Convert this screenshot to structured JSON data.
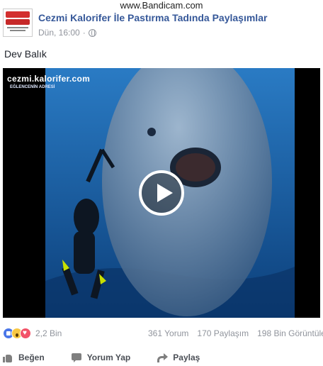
{
  "watermark": "www.Bandicam.com",
  "post": {
    "page_name": "Cezmi Kalorifer İle Pastırma Tadında Paylaşımlar",
    "timestamp": "Dün, 16:00",
    "separator": "·",
    "privacy_icon": "globe-icon",
    "text": "Dev Balık"
  },
  "avatar": {
    "logo_alt": "cezmi kalorifer logo"
  },
  "video": {
    "overlay_title": "cezmi.kalorifer.com",
    "overlay_subtitle": "EĞLENCENİN ADRESİ",
    "play_icon": "play-icon",
    "colors": {
      "water_top": "#1f6fb8",
      "water_bottom": "#0b3e78",
      "fish": "#8fa6bf"
    }
  },
  "stats": {
    "reactions": [
      "like-reaction-icon",
      "wow-reaction-icon",
      "love-reaction-icon"
    ],
    "reaction_count": "2,2 Bin",
    "comments": "361 Yorum",
    "shares": "170 Paylaşım",
    "views": "198 Bin Görüntüle"
  },
  "actions": {
    "like": "Beğen",
    "comment": "Yorum Yap",
    "share": "Paylaş"
  },
  "colors": {
    "link": "#365899",
    "meta": "#90949c",
    "action_text": "#4b4f56"
  }
}
